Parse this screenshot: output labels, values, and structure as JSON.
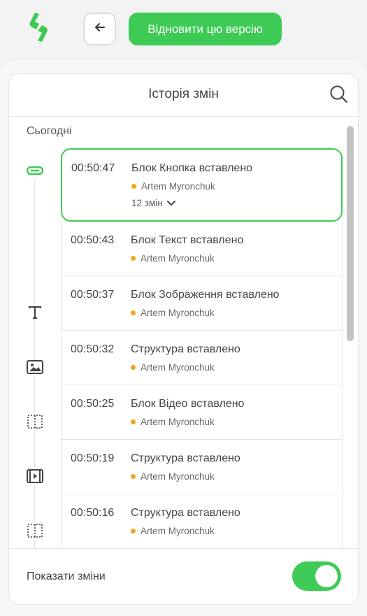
{
  "topbar": {
    "logo_icon": "lightning-logo-icon",
    "back_icon": "arrow-left-icon",
    "restore_label": "Відновити цю версію"
  },
  "panel": {
    "title": "Історія змін",
    "search_icon": "search-icon",
    "section_today": "Сьогодні",
    "entries": [
      {
        "icon": "button-block-icon",
        "time": "00:50:47",
        "description": "Блок Кнопка вставлено",
        "author": "Artem Myronchuk",
        "changes": "12 змін",
        "selected": true
      },
      {
        "icon": "text-block-icon",
        "time": "00:50:43",
        "description": "Блок Текст вставлено",
        "author": "Artem Myronchuk"
      },
      {
        "icon": "image-block-icon",
        "time": "00:50:37",
        "description": "Блок Зображення вставлено",
        "author": "Artem Myronchuk"
      },
      {
        "icon": "structure-icon",
        "time": "00:50:32",
        "description": "Структура вставлено",
        "author": "Artem Myronchuk"
      },
      {
        "icon": "video-block-icon",
        "time": "00:50:25",
        "description": "Блок Відео вставлено",
        "author": "Artem Myronchuk"
      },
      {
        "icon": "structure-icon",
        "time": "00:50:19",
        "description": "Структура вставлено",
        "author": "Artem Myronchuk"
      },
      {
        "icon": "structure-icon",
        "time": "00:50:16",
        "description": "Структура вставлено",
        "author": "Artem Myronchuk"
      }
    ],
    "footer_label": "Показати зміни",
    "show_changes_enabled": true
  },
  "colors": {
    "accent": "#3dcb55",
    "author_dot": "#f0a51b"
  }
}
